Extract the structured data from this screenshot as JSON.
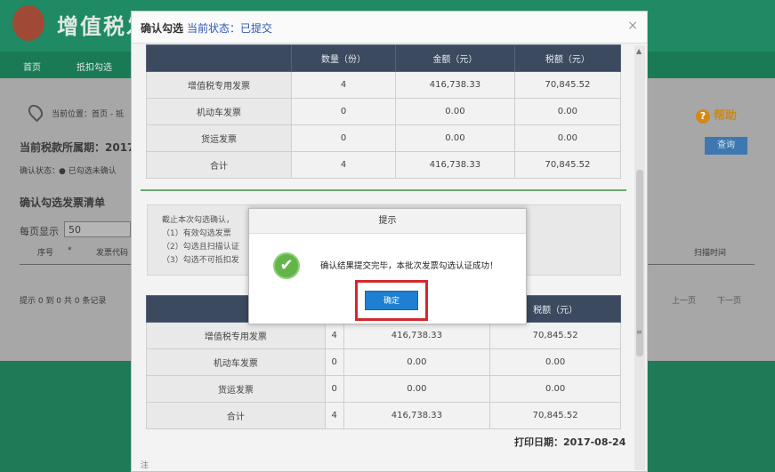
{
  "app": {
    "title": "增值税发",
    "nav": [
      "首页",
      "抵扣勾选"
    ],
    "location_label": "当前位置：首页 - 抵",
    "tax_period_label": "当前税款所属期：2017",
    "confirm_status_label": "确认状态：",
    "confirm_status_value": "● 已勾选未确认",
    "help_label": "帮助",
    "query_button": "查询",
    "list_title": "确认勾选发票清单",
    "page_size_label": "每页显示",
    "page_size_value": "50",
    "columns": [
      "序号",
      "*",
      "发票代码",
      "扫描时间"
    ],
    "pager_info": "提示 0 到 0 共 0 条记录",
    "prev_page": "上一页",
    "next_page": "下一页"
  },
  "dialog": {
    "title": "确认勾选",
    "status": "当前状态：已提交",
    "close_icon": "×",
    "table_headers": [
      "",
      "数量（份）",
      "金额（元）",
      "税额（元）"
    ],
    "table_rows": [
      {
        "label": "增值税专用发票",
        "count": "4",
        "amount": "416,738.33",
        "tax": "70,845.52"
      },
      {
        "label": "机动车发票",
        "count": "0",
        "amount": "0.00",
        "tax": "0.00"
      },
      {
        "label": "货运发票",
        "count": "0",
        "amount": "0.00",
        "tax": "0.00"
      },
      {
        "label": "合计",
        "count": "4",
        "amount": "416,738.33",
        "tax": "70,845.52"
      }
    ],
    "note_lines": [
      "截止本次勾选确认，",
      "（1）有效勾选发票",
      "（2）勾选且扫描认证",
      "（3）勾选不可抵扣发"
    ],
    "bottom_table_headers": [
      "",
      "",
      "",
      "税额（元）"
    ],
    "bottom_table_rows": [
      {
        "label": "增值税专用发票",
        "count": "4",
        "amount": "416,738.33",
        "tax": "70,845.52"
      },
      {
        "label": "机动车发票",
        "count": "0",
        "amount": "0.00",
        "tax": "0.00"
      },
      {
        "label": "货运发票",
        "count": "0",
        "amount": "0.00",
        "tax": "0.00"
      },
      {
        "label": "合计",
        "count": "4",
        "amount": "416,738.33",
        "tax": "70,845.52"
      }
    ],
    "print_date": "打印日期：2017-08-24",
    "bottom_note": "注"
  },
  "alert": {
    "title": "提示",
    "message": "确认结果提交完毕，本批次发票勾选认证成功！",
    "ok_button": "确定",
    "icon": "check-circle-icon"
  },
  "colors": {
    "header_green": "#1f8a63",
    "table_header": "#3c4a5f",
    "status_blue": "#2f56b0",
    "ok_button": "#1f7fd1",
    "highlight_red": "#d4282c"
  }
}
